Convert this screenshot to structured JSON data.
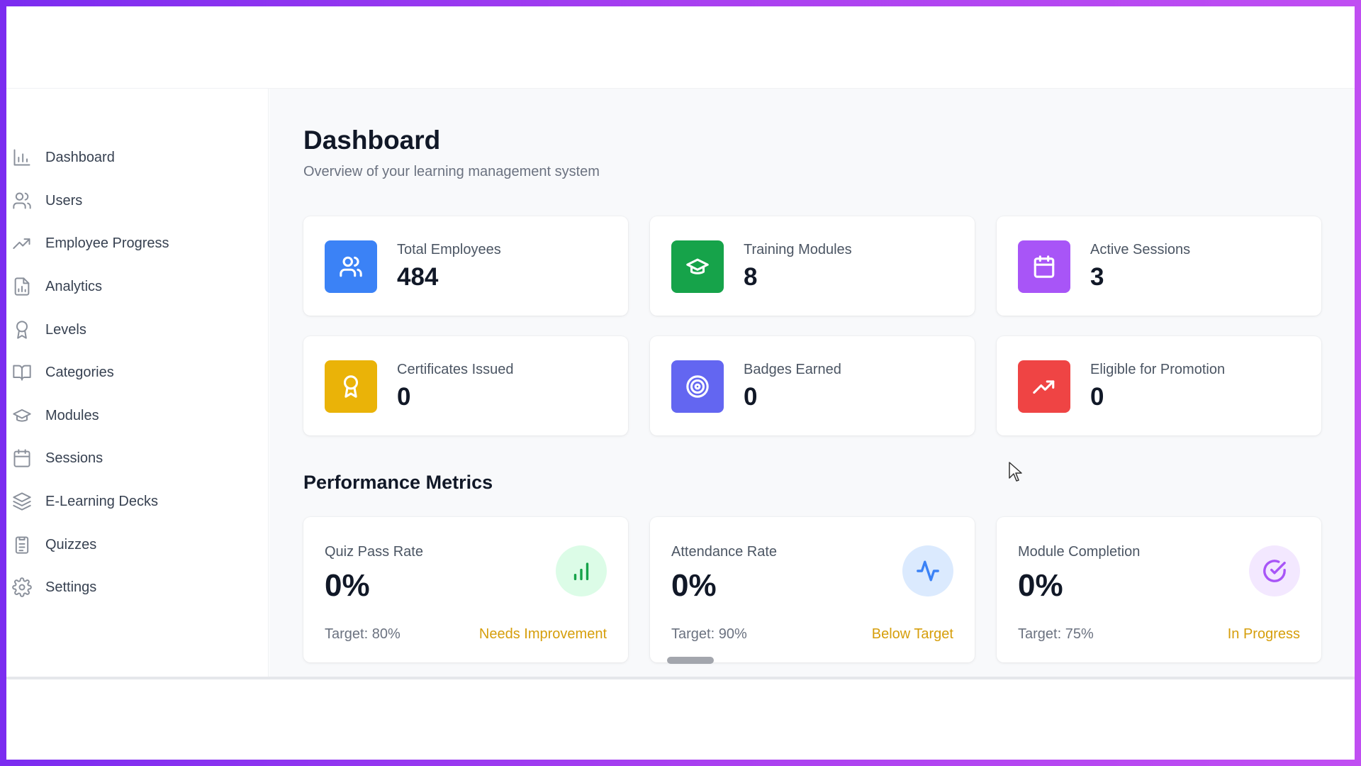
{
  "sidebar": {
    "items": [
      {
        "label": "Dashboard",
        "icon": "bar-chart-icon"
      },
      {
        "label": "Users",
        "icon": "users-icon"
      },
      {
        "label": "Employee Progress",
        "icon": "trending-up-icon"
      },
      {
        "label": "Analytics",
        "icon": "file-chart-icon"
      },
      {
        "label": "Levels",
        "icon": "award-icon"
      },
      {
        "label": "Categories",
        "icon": "book-open-icon"
      },
      {
        "label": "Modules",
        "icon": "graduation-cap-icon"
      },
      {
        "label": "Sessions",
        "icon": "calendar-icon"
      },
      {
        "label": "E-Learning Decks",
        "icon": "layers-icon"
      },
      {
        "label": "Quizzes",
        "icon": "clipboard-list-icon"
      },
      {
        "label": "Settings",
        "icon": "gear-icon"
      }
    ]
  },
  "header": {
    "title": "Dashboard",
    "subtitle": "Overview of your learning management system"
  },
  "stats": [
    {
      "label": "Total Employees",
      "value": "484",
      "icon": "users-icon",
      "color": "#3b82f6"
    },
    {
      "label": "Training Modules",
      "value": "8",
      "icon": "graduation-cap-icon",
      "color": "#16a34a"
    },
    {
      "label": "Active Sessions",
      "value": "3",
      "icon": "calendar-icon",
      "color": "#a855f7"
    },
    {
      "label": "Certificates Issued",
      "value": "0",
      "icon": "award-icon",
      "color": "#eab308"
    },
    {
      "label": "Badges Earned",
      "value": "0",
      "icon": "target-icon",
      "color": "#6366f1"
    },
    {
      "label": "Eligible for Promotion",
      "value": "0",
      "icon": "trending-up-icon",
      "color": "#ef4444"
    }
  ],
  "performance": {
    "title": "Performance Metrics",
    "metrics": [
      {
        "label": "Quiz Pass Rate",
        "value": "0%",
        "target": "Target: 80%",
        "status": "Needs Improvement",
        "icon": "bar-chart-icon",
        "color": "#16a34a",
        "bg": "#dcfce7"
      },
      {
        "label": "Attendance Rate",
        "value": "0%",
        "target": "Target: 90%",
        "status": "Below Target",
        "icon": "activity-icon",
        "color": "#3b82f6",
        "bg": "#dbeafe"
      },
      {
        "label": "Module Completion",
        "value": "0%",
        "target": "Target: 75%",
        "status": "In Progress",
        "icon": "check-circle-icon",
        "color": "#a855f7",
        "bg": "#f3e8ff"
      }
    ]
  },
  "colors": {
    "status_warning": "#d69e0b",
    "frame_gradient_start": "#7b2cf0",
    "frame_gradient_end": "#c04ef2"
  }
}
